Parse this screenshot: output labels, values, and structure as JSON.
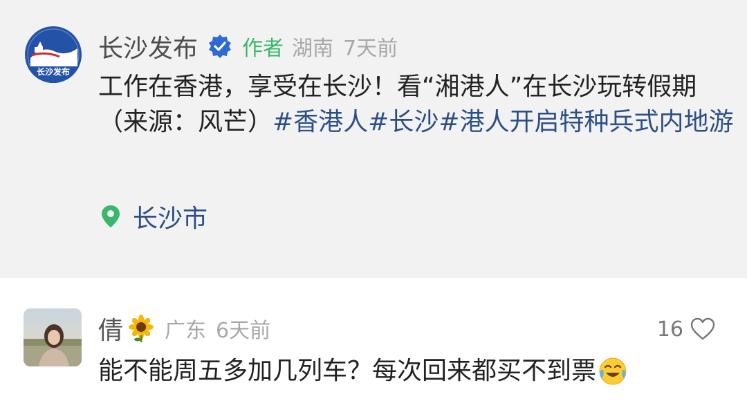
{
  "post": {
    "author_name": "长沙发布",
    "author_tag": "作者",
    "region": "湖南",
    "time": "7天前",
    "avatar_text": "长沙发布",
    "body_text": "工作在香港，享受在长沙！看“湘港人”在长沙玩转假期（来源：风芒）",
    "hashtags": "#香港人#长沙#港人开启特种兵式内地游",
    "location": "长沙市",
    "icons": [
      "verified-badge-icon",
      "location-pin-icon"
    ],
    "colors": {
      "tag": "#39b86c",
      "hashtag": "#2c4f86",
      "background": "#f2f2f2"
    }
  },
  "comment": {
    "name": "倩",
    "region": "广东",
    "time": "6天前",
    "likes": "16",
    "text": "能不能周五多加几列车？每次回来都买不到票",
    "icons": [
      "sunflower-icon",
      "heart-icon",
      "crying-laughing-emoji-icon"
    ]
  }
}
